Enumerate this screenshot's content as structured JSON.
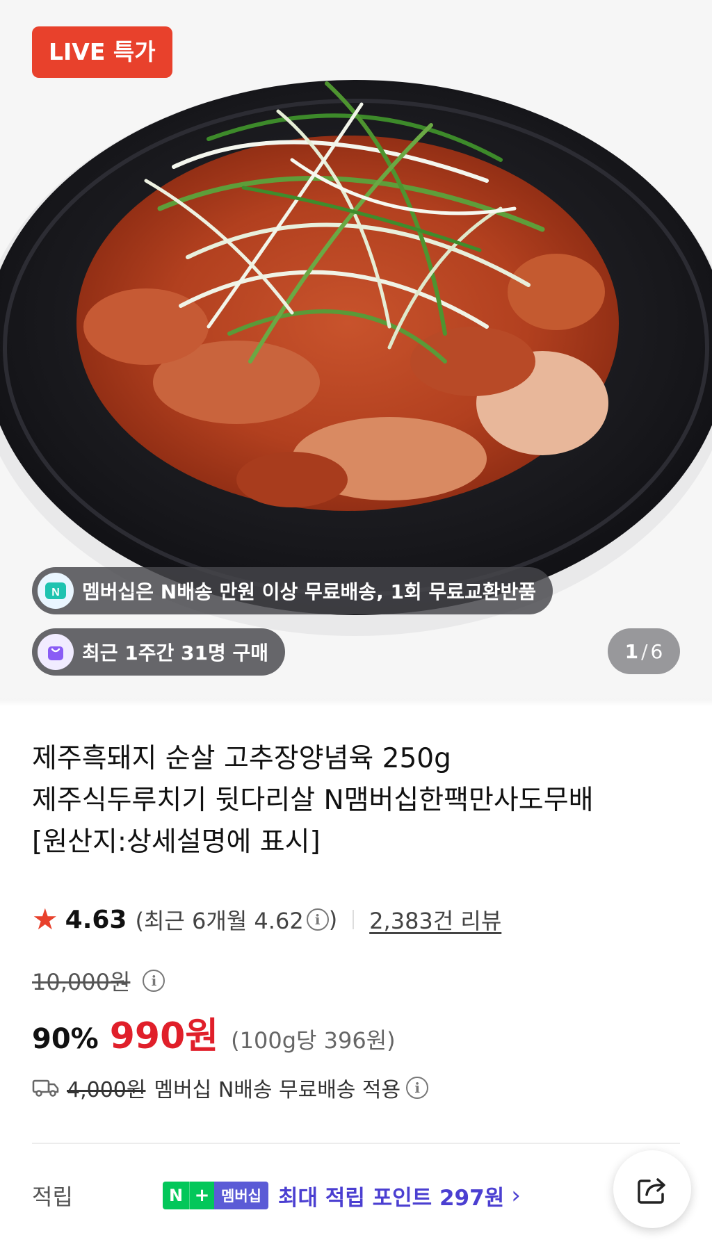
{
  "hero": {
    "live_badge": "LIVE 특가",
    "membership_notice": "멤버십은 N배송 만원 이상 무료배송, 1회 무료교환반품",
    "purchase_notice": "최근 1주간 31명 구매",
    "image_index": "1",
    "image_separator": "/",
    "image_total": "6"
  },
  "product": {
    "title_lines": [
      "제주흑돼지 순살 고추장양념육 250g",
      "제주식두루치기 뒷다리살 N맴버십한팩만사도무배",
      "[원산지:상세설명에 표시]"
    ]
  },
  "rating": {
    "score": "4.63",
    "recent_prefix": "(최근 6개월 4.62",
    "recent_suffix": ")",
    "info_glyph": "i",
    "review_count": "2,383건 리뷰"
  },
  "price": {
    "original": "10,000원",
    "discount": "90%",
    "sale": "990원",
    "unit_price": "(100g당 396원)"
  },
  "shipping": {
    "original_fee": "4,000원",
    "text": "멤버십 N배송 무료배송 적용"
  },
  "points": {
    "label": "적립",
    "badge_n": "N",
    "badge_plus": "+",
    "badge_membership": "멤버십",
    "text": "최대 적립 포인트 297원",
    "chevron": "›"
  },
  "colors": {
    "accent_red": "#e8412c",
    "price_red": "#e01f2a",
    "naver_green": "#03c75a",
    "membership_purple": "#4b3fd1"
  },
  "icons": {
    "star": "★",
    "share": "share-icon",
    "truck": "truck-icon"
  }
}
